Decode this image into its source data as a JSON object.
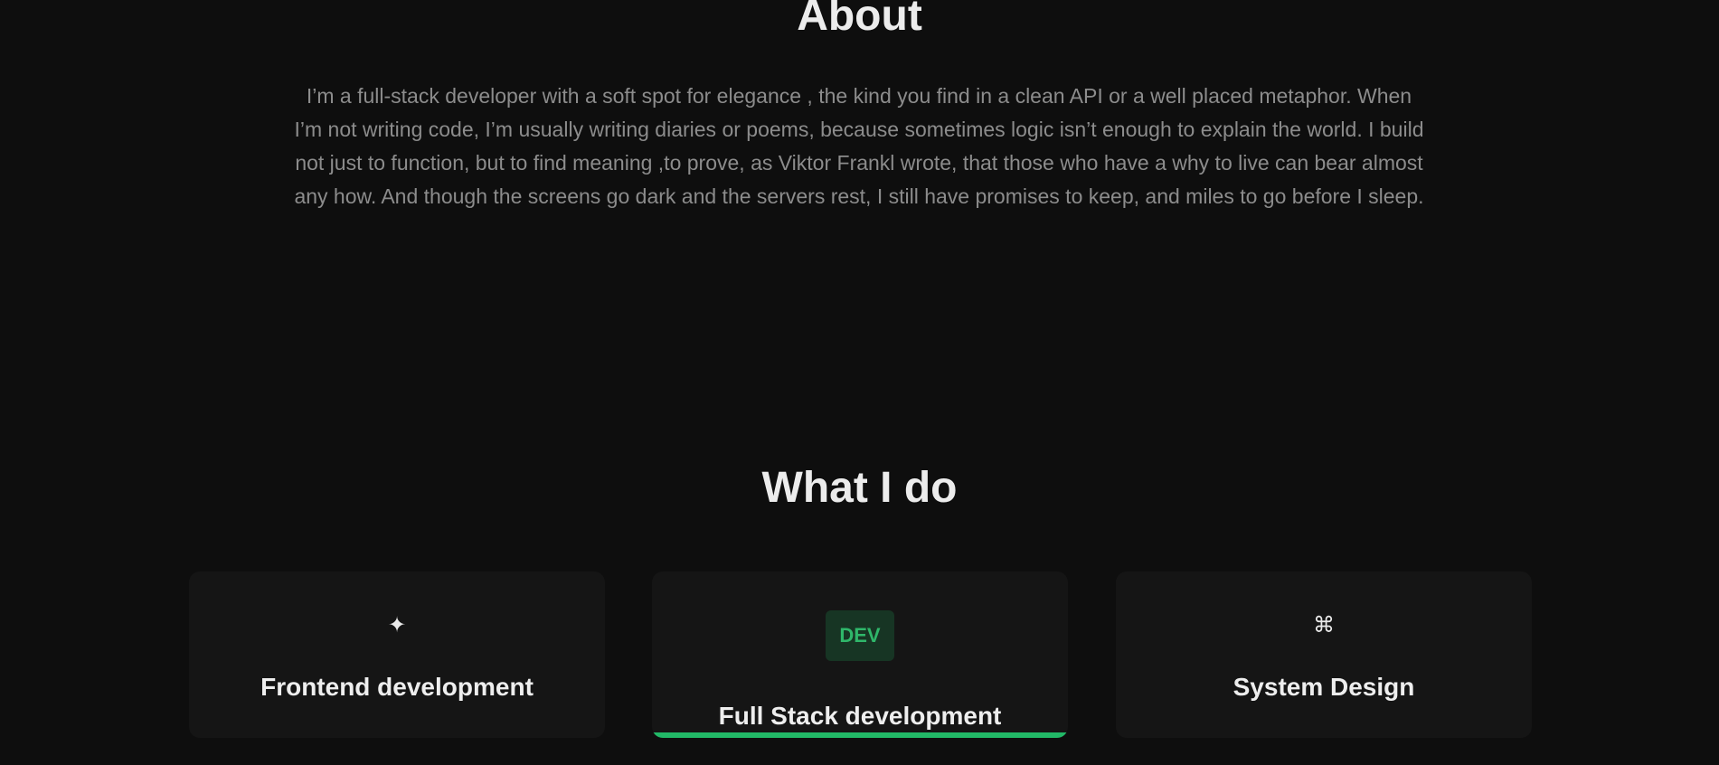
{
  "about": {
    "title": "About",
    "text": "I’m a full-stack developer with a soft spot for elegance , the kind you find in a clean API or a well placed metaphor. When I’m not writing code, I’m usually writing diaries or poems, because sometimes logic isn’t enough to explain the world. I build not just to function, but to find meaning ,to prove, as Viktor Frankl wrote, that those who have a why to live can bear almost any how. And though the screens go dark and the servers rest, I still have promises to keep, and miles to go before I sleep."
  },
  "what_i_do": {
    "title": "What I do",
    "cards": [
      {
        "icon": "✦",
        "icon_name": "sparkle-icon",
        "title": "Frontend development",
        "active": false
      },
      {
        "icon": "DEV",
        "icon_name": "dev-badge-icon",
        "title": "Full Stack development",
        "active": true
      },
      {
        "icon": "⌘",
        "icon_name": "command-icon",
        "title": "System Design",
        "active": false
      }
    ]
  },
  "colors": {
    "background": "#0e0e0e",
    "card": "#151515",
    "accent": "#22b867",
    "text_muted": "#8c8c8c"
  }
}
